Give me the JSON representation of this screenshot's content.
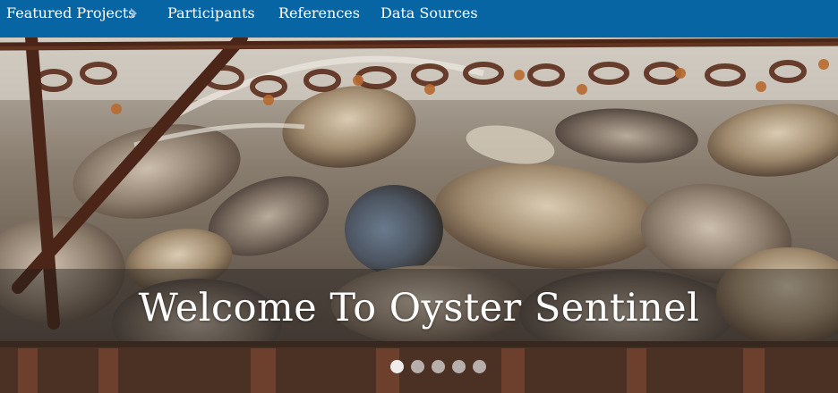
{
  "navbar": {
    "background_color": "#0765a4",
    "items": [
      {
        "label": "Featured Projects",
        "has_chevron": true,
        "icon": "chevron-right-icon"
      },
      {
        "label": "Participants"
      },
      {
        "label": "References"
      },
      {
        "label": "Data Sources"
      }
    ]
  },
  "hero": {
    "caption": "Welcome To Oyster Sentinel",
    "image_description_icon": "oyster-photo",
    "carousel": {
      "slide_count": 5,
      "active_index": 0
    }
  }
}
